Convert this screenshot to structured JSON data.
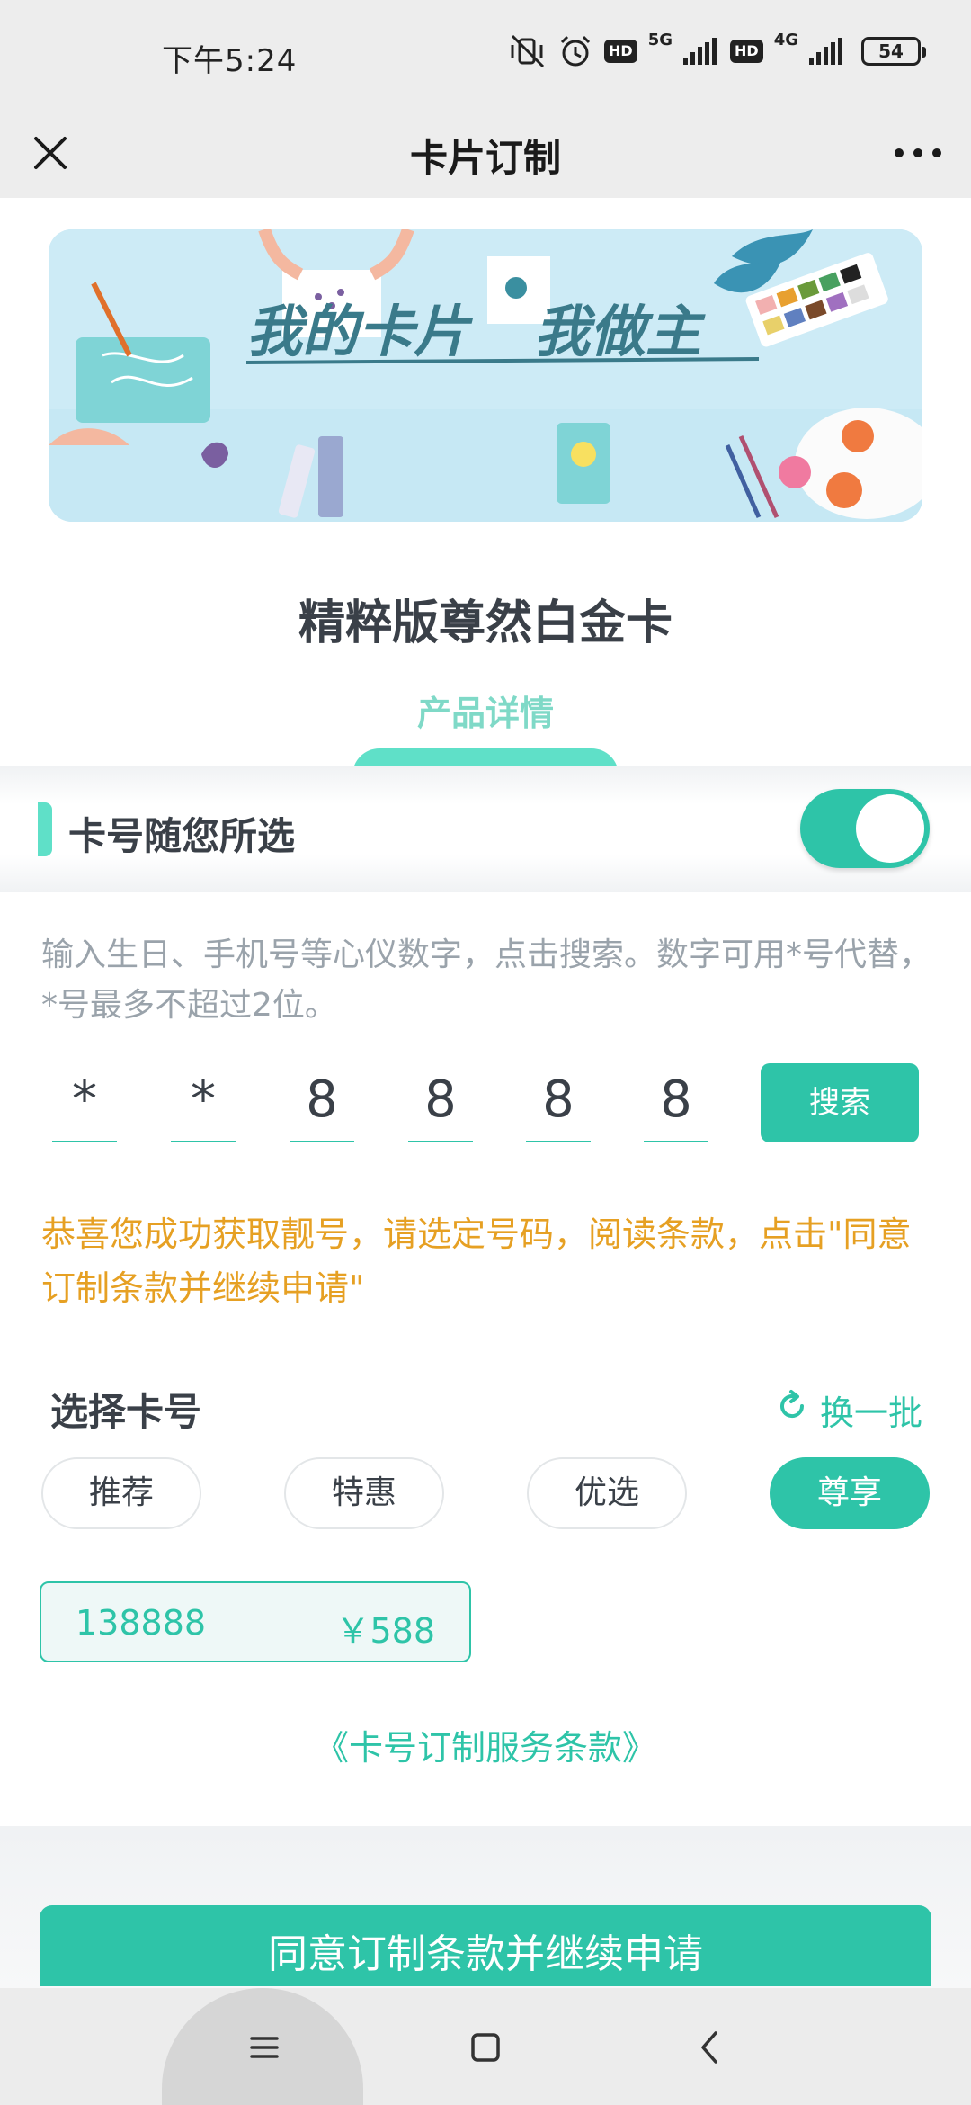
{
  "status_bar": {
    "time": "下午5:24",
    "network_1": "5G",
    "network_2": "4G",
    "hd_label": "HD",
    "battery": "54",
    "icons": [
      "vibrate-off-icon",
      "alarm-icon",
      "signal-icon",
      "battery-icon"
    ]
  },
  "nav": {
    "title": "卡片订制",
    "close_icon": "close-icon",
    "more_icon": "more-icon"
  },
  "banner": {
    "text_1": "我的卡片",
    "text_2": "我做主"
  },
  "product": {
    "name": "精粹版尊然白金卡",
    "tab_label": "产品详情"
  },
  "custom_number": {
    "label": "卡号随您所选",
    "enabled": true
  },
  "hint": "输入生日、手机号等心仪数字，点击搜索。数字可用*号代替，*号最多不超过2位。",
  "digits": [
    "*",
    "*",
    "8",
    "8",
    "8",
    "8"
  ],
  "search_label": "搜索",
  "success_message": "恭喜您成功获取靓号，请选定号码，阅读条款，点击\"同意订制条款并继续申请\"",
  "select": {
    "title": "选择卡号",
    "refresh_label": "换一批",
    "categories": [
      "推荐",
      "特惠",
      "优选",
      "尊享"
    ],
    "active_category": "尊享",
    "numbers": [
      {
        "number": "138888",
        "price": "￥588"
      }
    ]
  },
  "terms_link": "《卡号订制服务条款》",
  "agree_button": "同意订制条款并继续申请",
  "colors": {
    "accent": "#2ec4a8",
    "accent_light": "#5fe0c8",
    "warning": "#e6a023",
    "text": "#3a4048",
    "muted": "#9aa3ab"
  }
}
